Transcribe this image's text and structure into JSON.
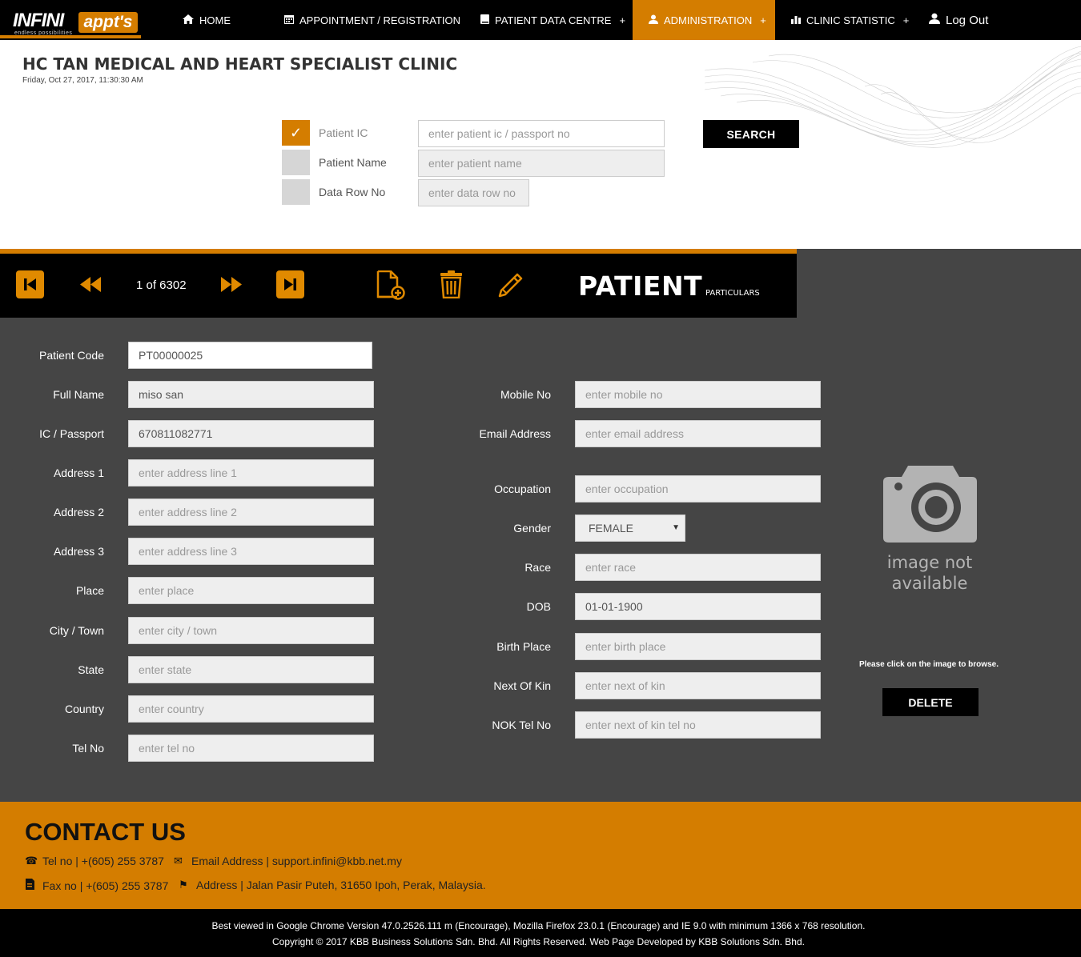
{
  "brand": {
    "logo_main": "INFINI",
    "logo_badge": "appt's",
    "logo_tagline": "endless possibilities",
    "accent_color": "#d47d00"
  },
  "nav": {
    "home": "HOME",
    "appointment": "APPOINTMENT / REGISTRATION",
    "patient_data": "PATIENT DATA CENTRE",
    "administration": "ADMINISTRATION",
    "clinic_statistic": "CLINIC STATISTIC",
    "logout": "Log Out",
    "expand_symbol": "+"
  },
  "header": {
    "clinic_name": "HC TAN MEDICAL AND HEART SPECIALIST CLINIC",
    "datetime": "Friday, Oct 27, 2017, 11:30:30 AM"
  },
  "search": {
    "options": [
      {
        "label": "Patient IC",
        "checked": true,
        "placeholder": "enter patient ic / passport no"
      },
      {
        "label": "Patient Name",
        "checked": false,
        "placeholder": "enter patient name"
      },
      {
        "label": "Data Row No",
        "checked": false,
        "placeholder": "enter data row no"
      }
    ],
    "check_mark": "✓",
    "button": "SEARCH"
  },
  "record": {
    "counter": "1 of 6302",
    "title": "PATIENT",
    "subtitle": "PARTICULARS",
    "icons": [
      "first-record-icon",
      "previous-record-icon",
      "next-record-icon",
      "last-record-icon",
      "new-record-icon",
      "delete-record-icon",
      "edit-record-icon"
    ]
  },
  "form_left": [
    {
      "label": "Patient Code",
      "value": "PT00000025",
      "placeholder": ""
    },
    {
      "label": "Full Name",
      "value": "miso san",
      "placeholder": ""
    },
    {
      "label": "IC / Passport",
      "value": "670811082771",
      "placeholder": ""
    },
    {
      "label": "Address 1",
      "value": "",
      "placeholder": "enter address line 1"
    },
    {
      "label": "Address 2",
      "value": "",
      "placeholder": "enter address line 2"
    },
    {
      "label": "Address 3",
      "value": "",
      "placeholder": "enter address line 3"
    },
    {
      "label": "Place",
      "value": "",
      "placeholder": "enter place"
    },
    {
      "label": "City / Town",
      "value": "",
      "placeholder": "enter city / town"
    },
    {
      "label": "State",
      "value": "",
      "placeholder": "enter state"
    },
    {
      "label": "Country",
      "value": "",
      "placeholder": "enter country"
    },
    {
      "label": "Tel No",
      "value": "",
      "placeholder": "enter tel no"
    }
  ],
  "form_right": [
    {
      "label": "Mobile No",
      "value": "",
      "placeholder": "enter mobile no"
    },
    {
      "label": "Email Address",
      "value": "",
      "placeholder": "enter email address"
    },
    {
      "label": "Occupation",
      "value": "",
      "placeholder": "enter occupation"
    },
    {
      "label": "Gender",
      "value": "FEMALE",
      "placeholder": ""
    },
    {
      "label": "Race",
      "value": "",
      "placeholder": "enter race"
    },
    {
      "label": "DOB",
      "value": "01-01-1900",
      "placeholder": ""
    },
    {
      "label": "Birth Place",
      "value": "",
      "placeholder": "enter birth place"
    },
    {
      "label": "Next Of Kin",
      "value": "",
      "placeholder": "enter next of kin"
    },
    {
      "label": "NOK Tel No",
      "value": "",
      "placeholder": "enter next of kin tel no"
    }
  ],
  "photo": {
    "caption_line1": "image not",
    "caption_line2": "available",
    "hint": "Please click on the image to browse.",
    "delete_button": "DELETE"
  },
  "contact": {
    "title": "CONTACT US",
    "tel": "Tel no | +(605) 255 3787",
    "email": "Email Address | support.infini@kbb.net.my",
    "fax": "Fax no | +(605) 255 3787",
    "address": "Address | Jalan Pasir Puteh, 31650 Ipoh, Perak, Malaysia."
  },
  "footer": {
    "browser_note": "Best viewed in Google Chrome Version 47.0.2526.111 m (Encourage), Mozilla Firefox 23.0.1 (Encourage) and IE 9.0 with minimum 1366 x 768 resolution.",
    "copyright": "Copyright © 2017 KBB Business Solutions Sdn. Bhd. All Rights Reserved. Web Page Developed by KBB Solutions Sdn. Bhd."
  }
}
